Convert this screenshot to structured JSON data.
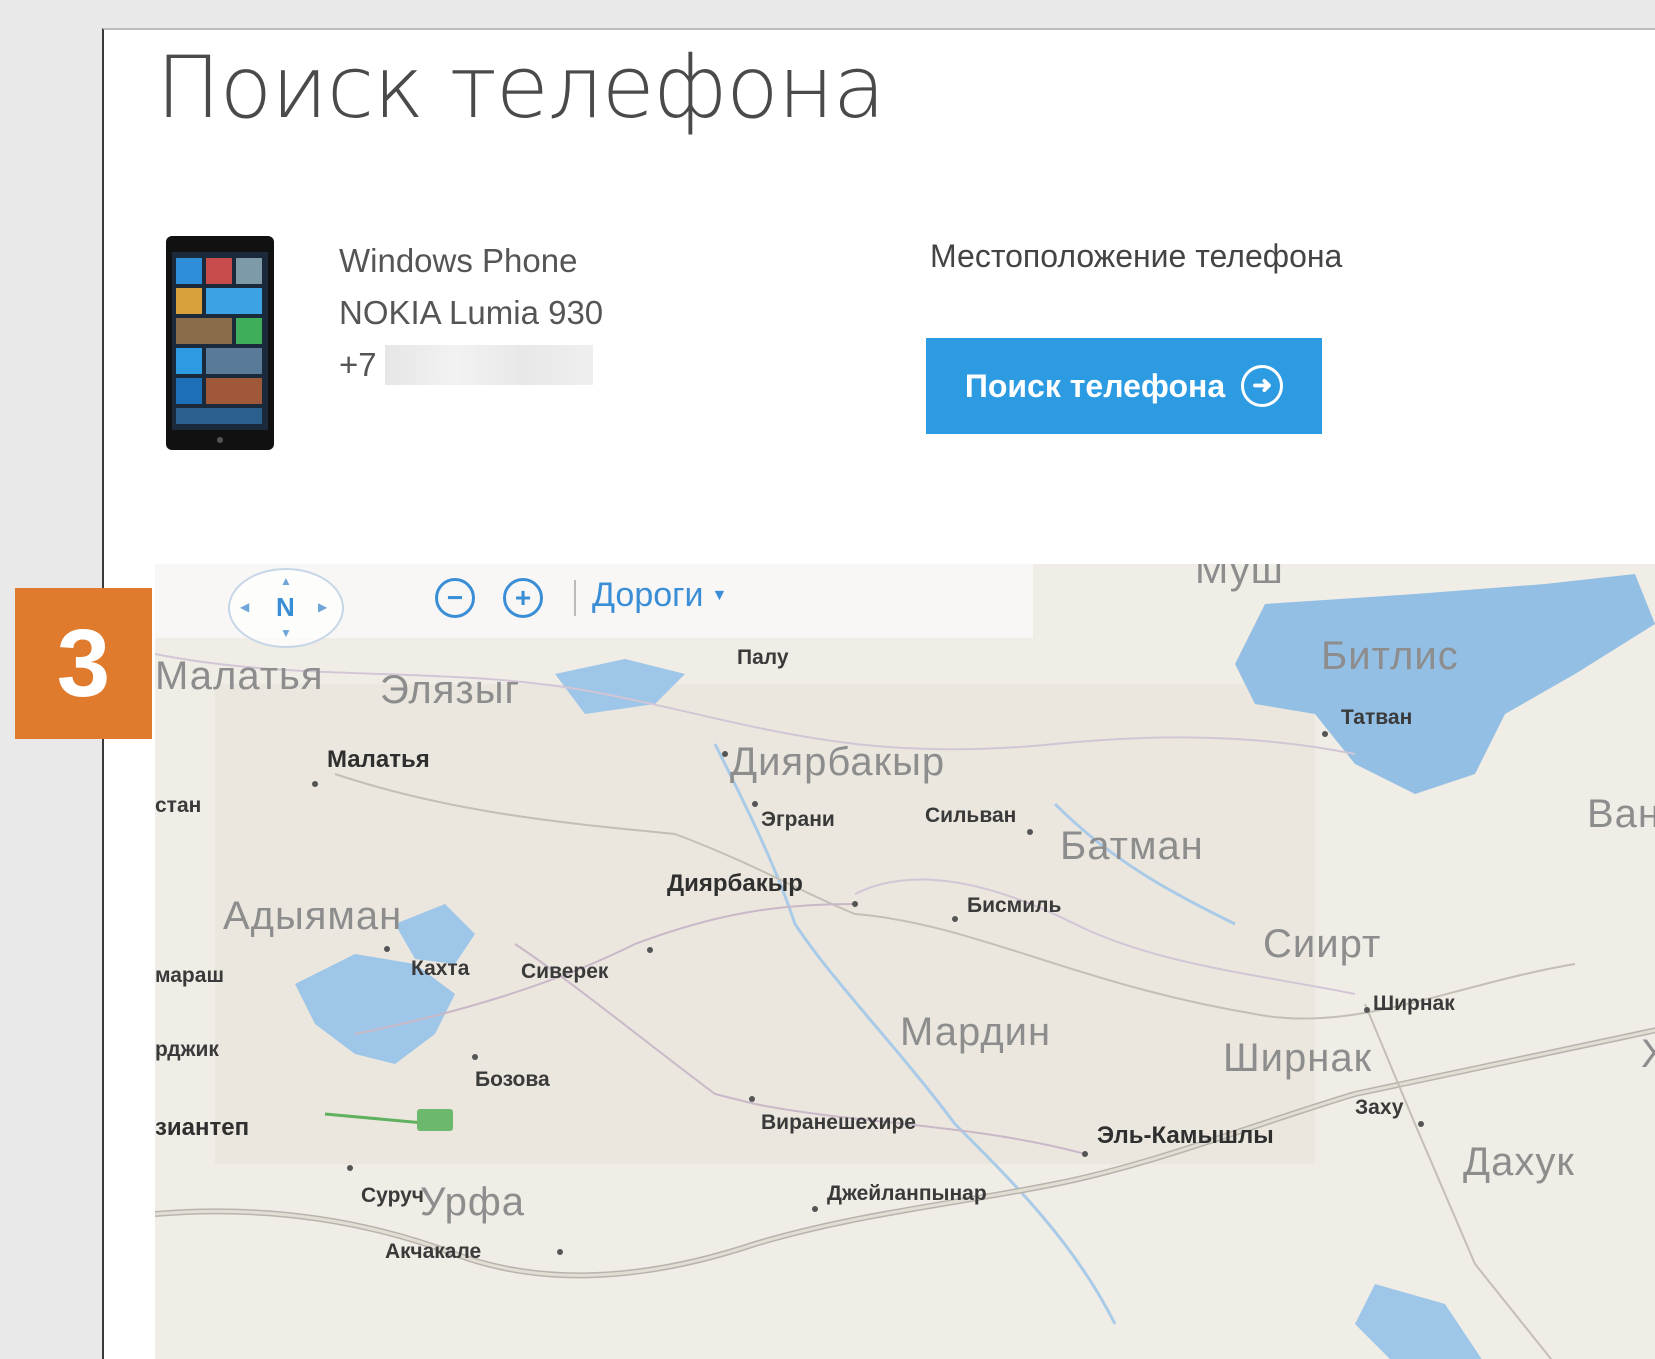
{
  "page": {
    "title": "Поиск телефона"
  },
  "device": {
    "brand": "Windows Phone",
    "model": "NOKIA Lumia 930",
    "number_prefix": "+7"
  },
  "location": {
    "label": "Местоположение телефона",
    "button_label": "Поиск телефона",
    "button_icon": "arrow-right-circle-icon",
    "button_color": "#2d9be2"
  },
  "map": {
    "controls": {
      "compass_label": "N",
      "zoom_out": "−",
      "zoom_in": "+",
      "style_label": "Дороги"
    },
    "provinces": [
      "Муш",
      "Битлис",
      "Ван",
      "Малатья",
      "Элязыг",
      "Диярбакыр",
      "Батман",
      "Адыяман",
      "Сиирт",
      "Мардин",
      "Ширнак",
      "Дахук",
      "Урфа"
    ],
    "cities": [
      "Палу",
      "Татван",
      "Малатья",
      "Эграни",
      "Сильван",
      "Диярбакыр",
      "Бисмиль",
      "Кахта",
      "Сиверек",
      "Ширнак",
      "Бозова",
      "Виранешехире",
      "Эль-Камышлы",
      "Заху",
      "Суруч",
      "Джейланпынар",
      "Акчакале"
    ],
    "edge_fragments": [
      "стан",
      "мараш",
      "рджик",
      "зиантеп",
      "Ха"
    ]
  },
  "step_badge": "3",
  "colors": {
    "accent": "#2d9be2",
    "badge": "#e07a2d",
    "water": "#93bfe4"
  }
}
